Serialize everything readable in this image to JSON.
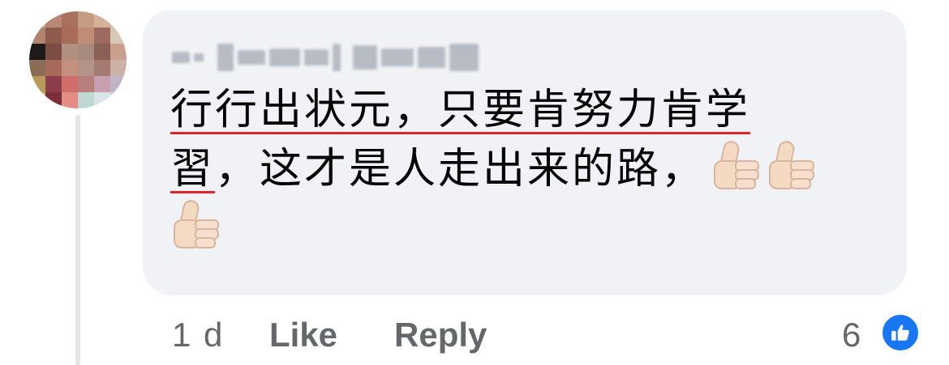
{
  "comment": {
    "author_redacted": true,
    "text_line1": "行行出状元，只要肯努力肯学",
    "text_line2_a": "習",
    "text_line2_b": "，这才是人走出来的路，",
    "emoji": [
      "thumbs-up",
      "thumbs-up",
      "thumbs-up"
    ]
  },
  "actions": {
    "time": "1 d",
    "like_label": "Like",
    "reply_label": "Reply",
    "reaction_count": "6",
    "reaction_icon": "like-icon"
  },
  "colors": {
    "bubble": "#f0f2f5",
    "meta_text": "#65676b",
    "like_blue": "#1877f2",
    "spell_underline": "#e0242b"
  }
}
